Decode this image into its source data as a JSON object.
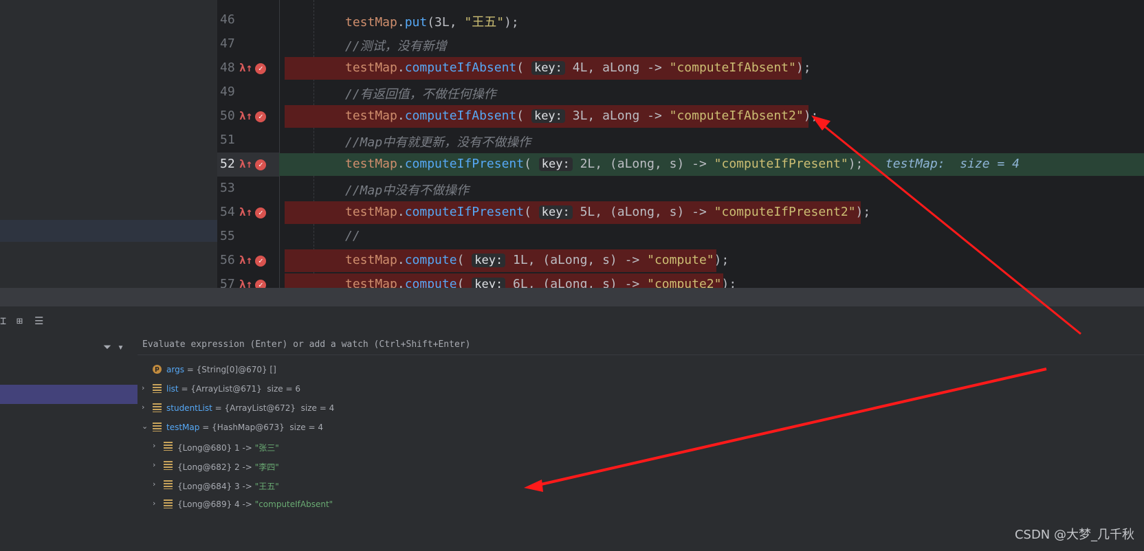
{
  "editor": {
    "lines": [
      {
        "num": "46",
        "kind": "plain",
        "parts": [
          [
            "id",
            "testMap"
          ],
          [
            "dot",
            "."
          ],
          [
            "m",
            "put"
          ],
          [
            "p",
            "(3L, "
          ],
          [
            "strj",
            "\"王五\""
          ],
          [
            "p",
            ");"
          ]
        ]
      },
      {
        "num": "47",
        "kind": "plain",
        "parts": [
          [
            "cmt",
            "//测试，没有新增"
          ]
        ]
      },
      {
        "num": "48",
        "kind": "red",
        "parts": [
          [
            "id",
            "testMap"
          ],
          [
            "dot",
            "."
          ],
          [
            "m",
            "computeIfAbsent"
          ],
          [
            "p",
            "( "
          ],
          [
            "hint",
            "key:"
          ],
          [
            "p",
            " 4L, aLong -> "
          ],
          [
            "strj",
            "\"computeIfAbsent\""
          ],
          [
            "p",
            ");"
          ]
        ]
      },
      {
        "num": "49",
        "kind": "plain",
        "parts": [
          [
            "cmt",
            "//有返回值，不做任何操作"
          ]
        ]
      },
      {
        "num": "50",
        "kind": "red",
        "parts": [
          [
            "id",
            "testMap"
          ],
          [
            "dot",
            "."
          ],
          [
            "m",
            "computeIfAbsent"
          ],
          [
            "p",
            "( "
          ],
          [
            "hint",
            "key:"
          ],
          [
            "p",
            " 3L, aLong -> "
          ],
          [
            "strj",
            "\"computeIfAbsent2\""
          ],
          [
            "p",
            ");"
          ]
        ]
      },
      {
        "num": "51",
        "kind": "plain",
        "parts": [
          [
            "cmt",
            "//Map中有就更新，没有不做操作"
          ]
        ]
      },
      {
        "num": "52",
        "kind": "green",
        "parts": [
          [
            "id",
            "testMap"
          ],
          [
            "dot",
            "."
          ],
          [
            "m",
            "computeIfPresent"
          ],
          [
            "p",
            "( "
          ],
          [
            "hint",
            "key:"
          ],
          [
            "p",
            " 2L, (aLong, s) -> "
          ],
          [
            "strj",
            "\"computeIfPresent\""
          ],
          [
            "p",
            ");   "
          ],
          [
            "inline",
            "testMap:  size = 4"
          ]
        ]
      },
      {
        "num": "53",
        "kind": "plain",
        "parts": [
          [
            "cmt",
            "//Map中没有不做操作"
          ]
        ]
      },
      {
        "num": "54",
        "kind": "red",
        "parts": [
          [
            "id",
            "testMap"
          ],
          [
            "dot",
            "."
          ],
          [
            "m",
            "computeIfPresent"
          ],
          [
            "p",
            "( "
          ],
          [
            "hint",
            "key:"
          ],
          [
            "p",
            " 5L, (aLong, s) -> "
          ],
          [
            "strj",
            "\"computeIfPresent2\""
          ],
          [
            "p",
            ");"
          ]
        ]
      },
      {
        "num": "55",
        "kind": "plain",
        "parts": [
          [
            "cmt",
            "//"
          ]
        ]
      },
      {
        "num": "56",
        "kind": "red",
        "parts": [
          [
            "id",
            "testMap"
          ],
          [
            "dot",
            "."
          ],
          [
            "m",
            "compute"
          ],
          [
            "p",
            "( "
          ],
          [
            "hint",
            "key:"
          ],
          [
            "p",
            " 1L, (aLong, s) -> "
          ],
          [
            "strj",
            "\"compute\""
          ],
          [
            "p",
            ");"
          ]
        ]
      },
      {
        "num": "57",
        "kind": "red",
        "parts": [
          [
            "id",
            "testMap"
          ],
          [
            "dot",
            "."
          ],
          [
            "m",
            "compute"
          ],
          [
            "p",
            "( "
          ],
          [
            "hint",
            "key:"
          ],
          [
            "p",
            " 6L, (aLong, s) -> "
          ],
          [
            "strj",
            "\"compute2\""
          ],
          [
            "p",
            ");"
          ]
        ]
      }
    ]
  },
  "debug": {
    "eval_placeholder": "Evaluate expression (Enter) or add a watch (Ctrl+Shift+Enter)",
    "variables": [
      {
        "arrow": "",
        "icon": "p",
        "name": "args",
        "value": " = {String[0]@670} []"
      },
      {
        "arrow": "›",
        "icon": "f",
        "name": "list",
        "value": " = {ArrayList@671}  size = 6"
      },
      {
        "arrow": "›",
        "icon": "f",
        "name": "studentList",
        "value": " = {ArrayList@672}  size = 4"
      },
      {
        "arrow": "⌄",
        "icon": "f",
        "name": "testMap",
        "value": " = {HashMap@673}  size = 4"
      }
    ],
    "entries": [
      {
        "prefix": "{Long@680} 1 -> ",
        "val": "\"张三\""
      },
      {
        "prefix": "{Long@682} 2 -> ",
        "val": "\"李四\""
      },
      {
        "prefix": "{Long@684} 3 -> ",
        "val": "\"王五\""
      },
      {
        "prefix": "{Long@689} 4 -> ",
        "val": "\"computeIfAbsent\""
      }
    ]
  },
  "watermark": "CSDN @大梦_几千秋",
  "colors": {
    "arrow": "#ff1a1a",
    "red_line": "#5a1d1d",
    "green_line": "#294436"
  }
}
